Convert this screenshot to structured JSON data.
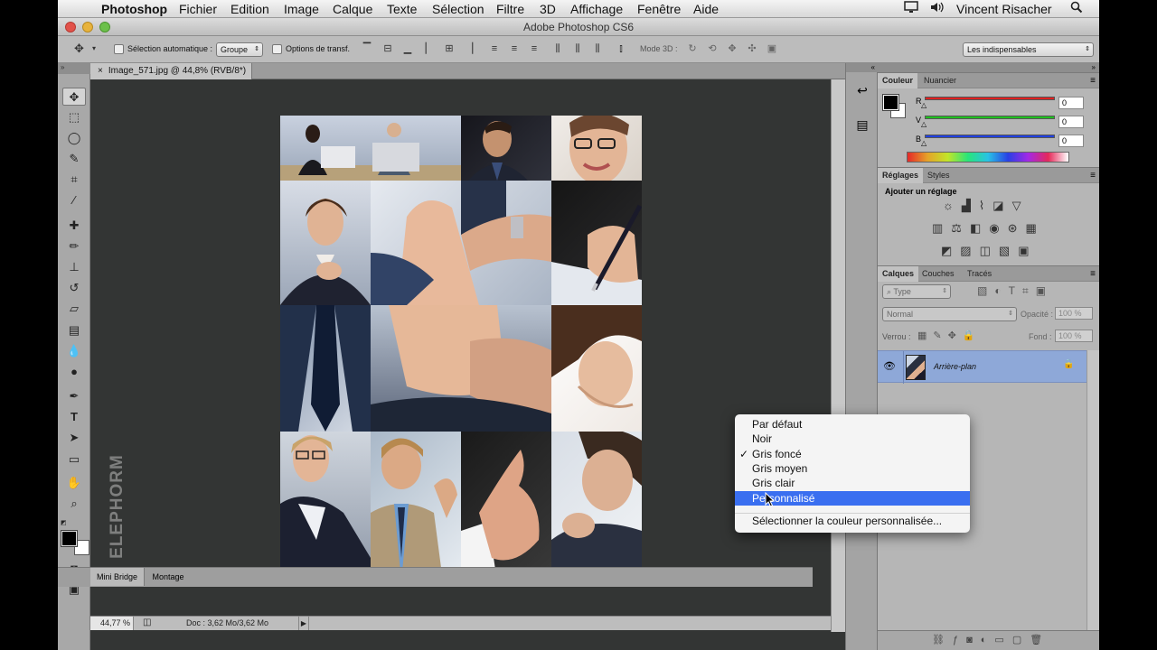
{
  "menubar": {
    "app": "Photoshop",
    "items": [
      "Fichier",
      "Edition",
      "Image",
      "Calque",
      "Texte",
      "Sélection",
      "Filtre",
      "3D",
      "Affichage",
      "Fenêtre",
      "Aide"
    ],
    "user": "Vincent Risacher"
  },
  "window": {
    "title": "Adobe Photoshop CS6"
  },
  "options": {
    "auto_select_label": "Sélection automatique :",
    "auto_select_value": "Groupe",
    "transform_label": "Options de transf.",
    "mode3d_label": "Mode 3D :",
    "workspace": "Les indispensables"
  },
  "document": {
    "tab_title": "Image_571.jpg @ 44,8% (RVB/8*)",
    "zoom": "44,77 %",
    "doc_size": "Doc : 3,62 Mo/3,62 Mo"
  },
  "bottom_tabs": [
    "Mini Bridge",
    "Montage"
  ],
  "color_panel": {
    "tabs": [
      "Couleur",
      "Nuancier"
    ],
    "channels": [
      {
        "label": "R",
        "value": "0",
        "color": "#e02020"
      },
      {
        "label": "V",
        "value": "0",
        "color": "#20c020"
      },
      {
        "label": "B",
        "value": "0",
        "color": "#2040e0"
      }
    ]
  },
  "adjust_panel": {
    "tabs": [
      "Réglages",
      "Styles"
    ],
    "title": "Ajouter un réglage"
  },
  "layers_panel": {
    "tabs": [
      "Calques",
      "Couches",
      "Tracés"
    ],
    "filter_placeholder": "Type",
    "blend_mode": "Normal",
    "opacity_label": "Opacité :",
    "opacity_value": "100 %",
    "lock_label": "Verrou :",
    "fill_label": "Fond :",
    "fill_value": "100 %",
    "layer_name": "Arrière-plan"
  },
  "context_menu": {
    "items": [
      {
        "label": "Par défaut",
        "checked": false,
        "highlighted": false
      },
      {
        "label": "Noir",
        "checked": false,
        "highlighted": false
      },
      {
        "label": "Gris foncé",
        "checked": true,
        "highlighted": false
      },
      {
        "label": "Gris moyen",
        "checked": false,
        "highlighted": false
      },
      {
        "label": "Gris clair",
        "checked": false,
        "highlighted": false
      },
      {
        "label": "Personnalisé",
        "checked": false,
        "highlighted": true
      }
    ],
    "extra_item": "Sélectionner la couleur personnalisée...",
    "check_mark": "✓"
  },
  "watermark": "ELEPHORM"
}
